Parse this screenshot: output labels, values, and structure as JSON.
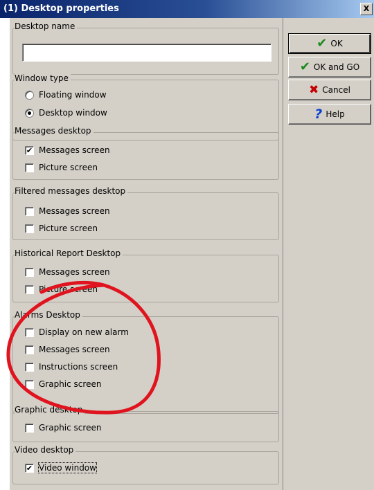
{
  "window": {
    "title": "(1) Desktop properties",
    "close_glyph": "X"
  },
  "groups": {
    "desktop_name": {
      "label": "Desktop name",
      "value": ""
    },
    "window_type": {
      "label": "Window type",
      "options": [
        {
          "label": "Floating window",
          "selected": false
        },
        {
          "label": "Desktop window",
          "selected": true
        }
      ]
    },
    "messages_desktop": {
      "label": "Messages desktop",
      "items": [
        {
          "label": "Messages screen",
          "checked": true
        },
        {
          "label": "Picture screen",
          "checked": false
        }
      ]
    },
    "filtered_messages_desktop": {
      "label": "Filtered messages desktop",
      "items": [
        {
          "label": "Messages screen",
          "checked": false
        },
        {
          "label": "Picture screen",
          "checked": false
        }
      ]
    },
    "historical_report_desktop": {
      "label": "Historical Report Desktop",
      "items": [
        {
          "label": "Messages screen",
          "checked": false
        },
        {
          "label": "Picture screen",
          "checked": false
        }
      ]
    },
    "alarms_desktop": {
      "label": "Alarms Desktop",
      "items": [
        {
          "label": "Display on new alarm",
          "checked": false
        },
        {
          "label": "Messages screen",
          "checked": false
        },
        {
          "label": "Instructions screen",
          "checked": false
        },
        {
          "label": "Graphic screen",
          "checked": false
        }
      ]
    },
    "graphic_desktop": {
      "label": "Graphic desktop",
      "items": [
        {
          "label": "Graphic screen",
          "checked": false
        }
      ]
    },
    "video_desktop": {
      "label": "Video desktop",
      "items": [
        {
          "label": "Video window",
          "checked": true
        }
      ]
    }
  },
  "buttons": {
    "ok": {
      "label": "OK",
      "icon": "green-check-icon"
    },
    "ok_and_go": {
      "label": "OK and GO",
      "icon": "green-check-icon"
    },
    "cancel": {
      "label": "Cancel",
      "icon": "red-x-icon"
    },
    "help": {
      "label": "Help",
      "icon": "blue-question-icon"
    }
  },
  "annotation": {
    "shape": "hand-drawn-circle",
    "color": "#e0141e"
  },
  "colors": {
    "dialog_bg": "#d4d0c8",
    "title_bar": "#0a246a"
  }
}
